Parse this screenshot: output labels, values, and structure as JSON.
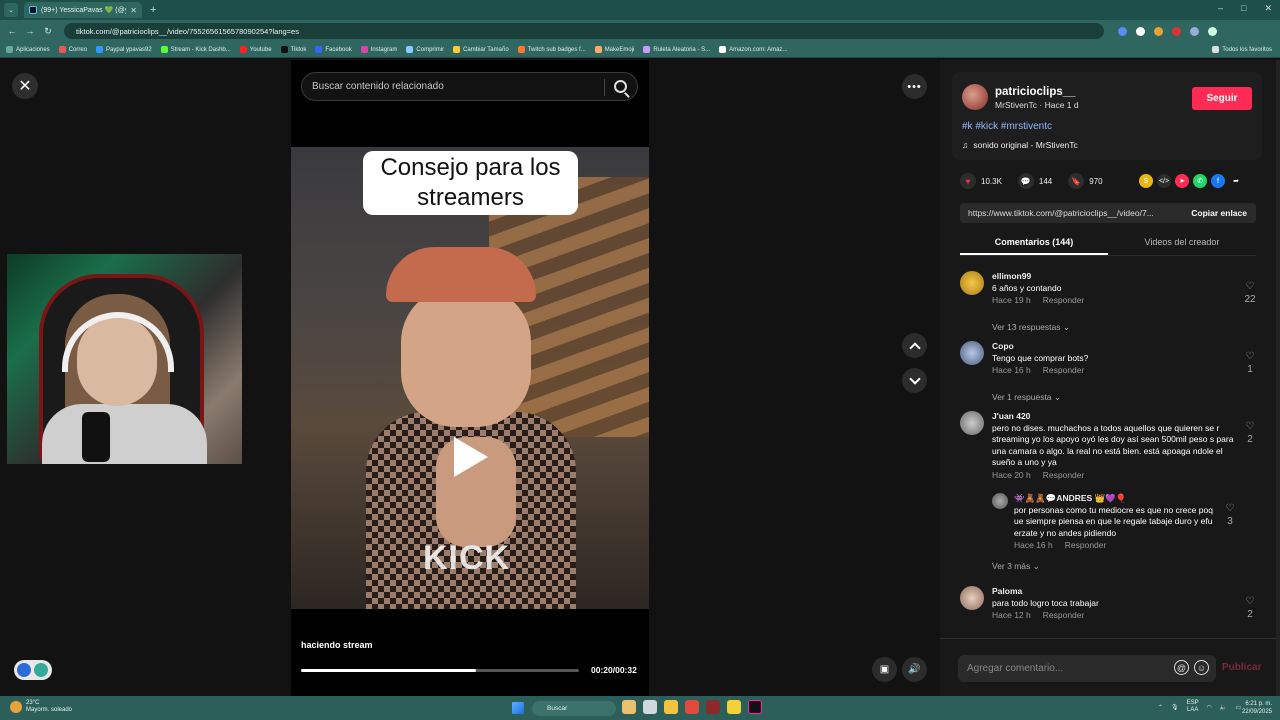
{
  "browser": {
    "tab_title": "(99+) YessicaPavas 💚 (@y...",
    "url": "tiktok.com/@patricioclips__/video/7552656156578090254?lang=es",
    "bookmarks": [
      "Aplicaciones",
      "Correo",
      "Paypal ypavas92",
      "Stream - Kick Dashb...",
      "Youtube",
      "Tiktok",
      "Facebook",
      "Instagram",
      "Comprimir",
      "Cambiar Tamaño",
      "Twitch sub badges f...",
      "MakeEmoji",
      "Ruleta Aleatoria - S...",
      "Amazon.com: Amaz..."
    ],
    "bookmarks_right": "Todos los favoritos",
    "window_controls": [
      "–",
      "□",
      "✕"
    ]
  },
  "video": {
    "search_placeholder": "Buscar contenido relacionado",
    "caption": "Consejo para los streamers",
    "overlay_logo_text": "KICK",
    "description": "haciendo stream",
    "time": "00:20/00:32",
    "progress": 0.63
  },
  "author": {
    "username": "patricioclips__",
    "meta": "MrStivenTc · Hace 1 d",
    "follow_label": "Seguir",
    "hashtags": "#k #kick #mrstiventc",
    "sound": "sonido original - MrStivenTc"
  },
  "stats": {
    "likes": "10.3K",
    "comments": "144",
    "saves": "970"
  },
  "link": {
    "url": "https://www.tiktok.com/@patricioclips__/video/7...",
    "copy_label": "Copiar enlace"
  },
  "tabs": {
    "comments": "Comentarios (144)",
    "creator_videos": "Videos del creador"
  },
  "comments": [
    {
      "user": "ellimon99",
      "text": "6 años y contando",
      "time": "Hace 19 h",
      "reply": "Responder",
      "likes": "22",
      "more": "Ver 13 respuestas"
    },
    {
      "user": "Copo",
      "text": "Tengo que comprar bots?",
      "time": "Hace 16 h",
      "reply": "Responder",
      "likes": "1",
      "more": "Ver 1 respuesta"
    },
    {
      "user": "J'uan 420",
      "text": "pero no dises. muchachos a todos aquellos que quieren se r streaming yo los apoyo oyó les doy así sean 500mil peso s para una camara o algo. la real no está bien. está apoaga ndole el sueño a uno y ya",
      "time": "Hace 20 h",
      "reply": "Responder",
      "likes": "2",
      "more": "Ver 3 más"
    },
    {
      "user": "Paloma",
      "text": "para todo logro toca trabajar",
      "time": "Hace 12 h",
      "reply": "Responder",
      "likes": "2"
    }
  ],
  "nested_reply": {
    "user": "👾🧸🧸💬ANDRES 👑💜🎈",
    "text": "por personas como tu mediocre es que no crece poq ue siempre piensa en que le regale tabaje duro y efu erzate y no andes pidiendo",
    "time": "Hace 16 h",
    "reply": "Responder",
    "likes": "3"
  },
  "comment_input": {
    "placeholder": "Agregar comentario...",
    "post_label": "Publicar"
  },
  "taskbar": {
    "weather_temp": "23°C",
    "weather_desc": "Mayorm. soleado",
    "search": "Buscar",
    "lang": "ESP",
    "lang2": "LAA",
    "time": "6:21 p. m.",
    "date": "22/09/2025"
  },
  "colors": {
    "accent": "#fe2c55",
    "link": "#8fb8ff",
    "panel": "#181818",
    "chrome": "#2f6660"
  }
}
